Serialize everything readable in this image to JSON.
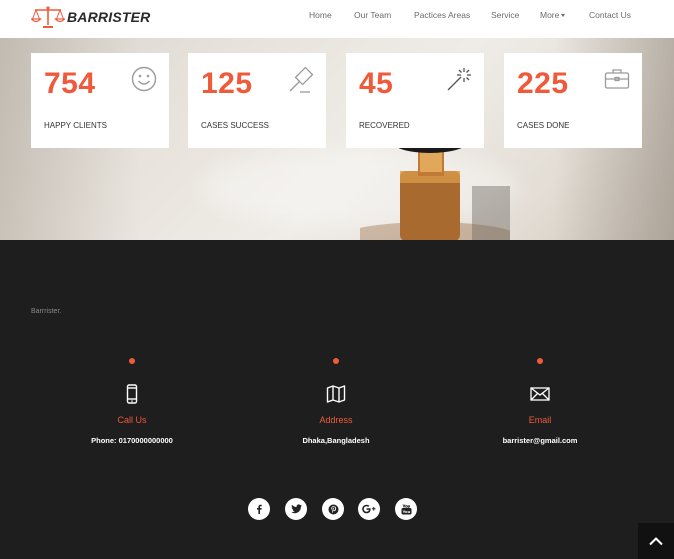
{
  "brand": {
    "name": "BARRISTER",
    "accent": "#ef5a3b"
  },
  "nav": {
    "items": [
      {
        "label": "Home"
      },
      {
        "label": "Our Team"
      },
      {
        "label": "Pactices Areas"
      },
      {
        "label": "Service"
      },
      {
        "label": "More",
        "icon": "chevron-down-icon"
      },
      {
        "label": "Contact Us"
      }
    ]
  },
  "stats": [
    {
      "value": "754",
      "label": "HAPPY CLIENTS",
      "icon": "smiley-icon"
    },
    {
      "value": "125",
      "label": "CASES SUCCESS",
      "icon": "gavel-icon"
    },
    {
      "value": "45",
      "label": "RECOVERED",
      "icon": "magic-wand-icon"
    },
    {
      "value": "225",
      "label": "CASES DONE",
      "icon": "briefcase-icon"
    }
  ],
  "footer": {
    "brand_text": "Barrrister.",
    "contacts": [
      {
        "title": "Call Us",
        "value": "Phone: 0170000000000",
        "icon": "mobile-phone-icon"
      },
      {
        "title": "Address",
        "value": "Dhaka,Bangladesh",
        "icon": "map-icon"
      },
      {
        "title": "Email",
        "value": "barrister@gmail.com",
        "icon": "envelope-icon"
      }
    ],
    "socials": [
      "facebook-icon",
      "twitter-icon",
      "pinterest-icon",
      "google-plus-icon",
      "youtube-icon"
    ]
  },
  "back_to_top": {
    "icon": "chevron-up-icon"
  }
}
